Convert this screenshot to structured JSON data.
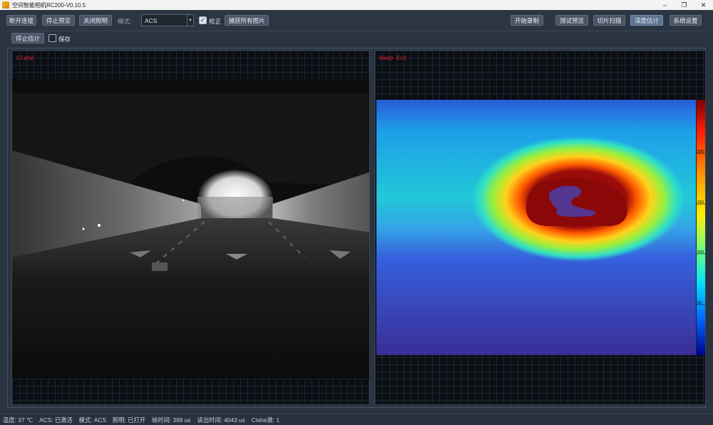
{
  "window": {
    "title": "空间智能相机RC200-V0.10.5",
    "minimize": "–",
    "maximize": "❐",
    "close": "✕"
  },
  "toolbar": {
    "disconnect": "断开连接",
    "stop_preview": "停止预览",
    "lighting_off": "关闭照明",
    "mode_label": "模式:",
    "mode_value": "ACS",
    "correction_label": "校正",
    "correction_checked": true,
    "capture_all": "捕获所有图片",
    "start_record": "开始录制",
    "test_preview": "测试预览",
    "slice_scan": "切片扫描",
    "depth_estimate": "深度估计",
    "system_settings": "系统设置"
  },
  "subbar": {
    "stop_estimate": "停止估计",
    "save_label": "保存",
    "save_checked": false
  },
  "views": {
    "left": {
      "label": "Clahe"
    },
    "right": {
      "label": "Deep Est",
      "colorbar_ticks": [
        "200",
        "150",
        "100",
        "50"
      ]
    }
  },
  "status": {
    "temperature": "温度: 37 ℃",
    "acs": "ACS: 已激活",
    "mode": "模式: ACS",
    "lighting": "照明: 已打开",
    "frame_time": "帧时间: 399 us",
    "readout_time": "读出时间: 4043 us",
    "clahe": "Clahe激: 1"
  },
  "colors": {
    "accent": "#5c7391",
    "background": "#2a3340",
    "label_red": "#e02020"
  }
}
